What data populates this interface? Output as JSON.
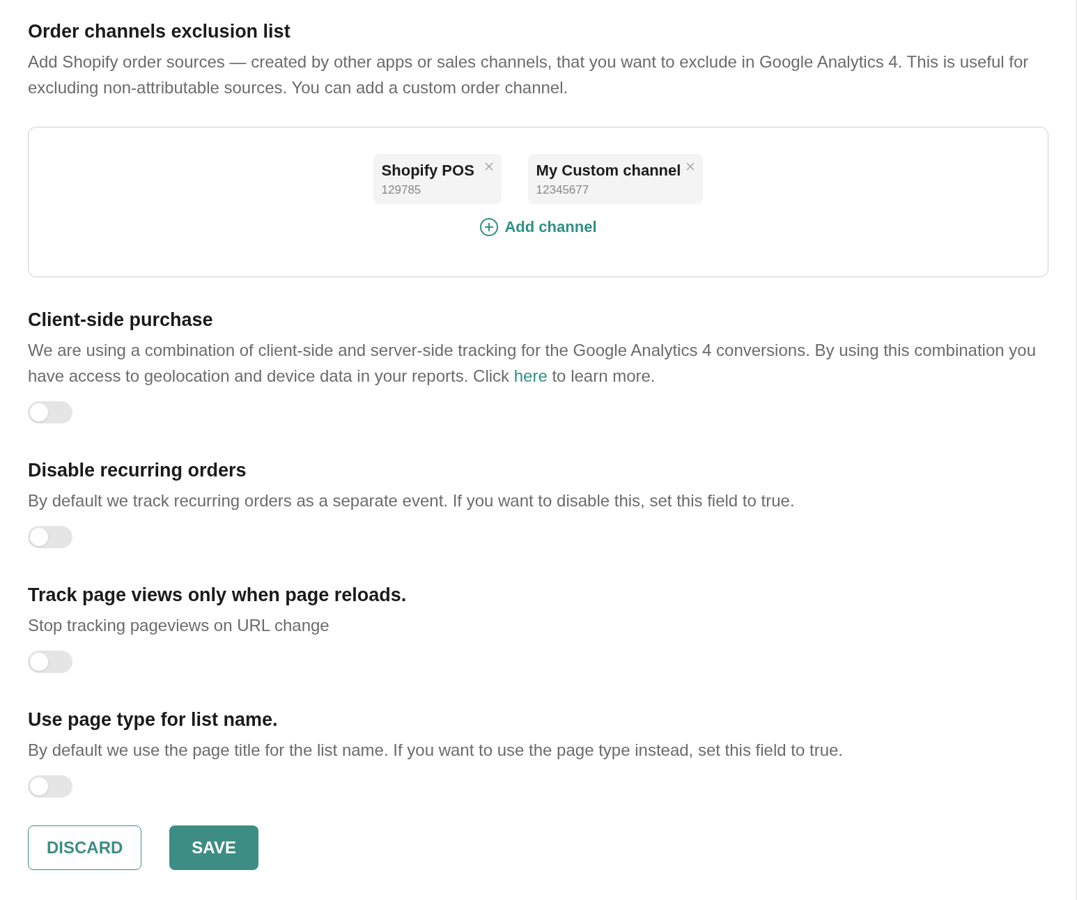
{
  "channels_section": {
    "title": "Order channels exclusion list",
    "description": "Add Shopify order sources — created by other apps or sales channels, that you want to exclude in Google Analytics 4. This is useful for excluding non-attributable sources. You can add a custom order channel.",
    "channels": [
      {
        "name": "Shopify POS",
        "id": "129785"
      },
      {
        "name": "My Custom channel",
        "id": "12345677"
      }
    ],
    "add_label": "Add channel"
  },
  "settings": [
    {
      "title": "Client-side purchase",
      "description": "We are using a combination of client-side and server-side tracking for the Google Analytics 4 conversions. By using this combination you have access to geolocation and device data in your reports. Click ",
      "link": "here",
      "description_after": " to learn more.",
      "on": false
    },
    {
      "title": "Disable recurring orders",
      "description": "By default we track recurring orders as a separate event. If you want to disable this, set this field to true.",
      "on": false
    },
    {
      "title": "Track page views only when page reloads.",
      "description": "Stop tracking pageviews on URL change",
      "on": false
    },
    {
      "title": "Use page type for list name.",
      "description": "By default we use the page title for the list name. If you want to use the page type instead, set this field to true.",
      "on": false
    }
  ],
  "buttons": [
    {
      "label": "DISCARD",
      "kind": "outline"
    },
    {
      "label": "SAVE",
      "kind": "primary"
    }
  ]
}
